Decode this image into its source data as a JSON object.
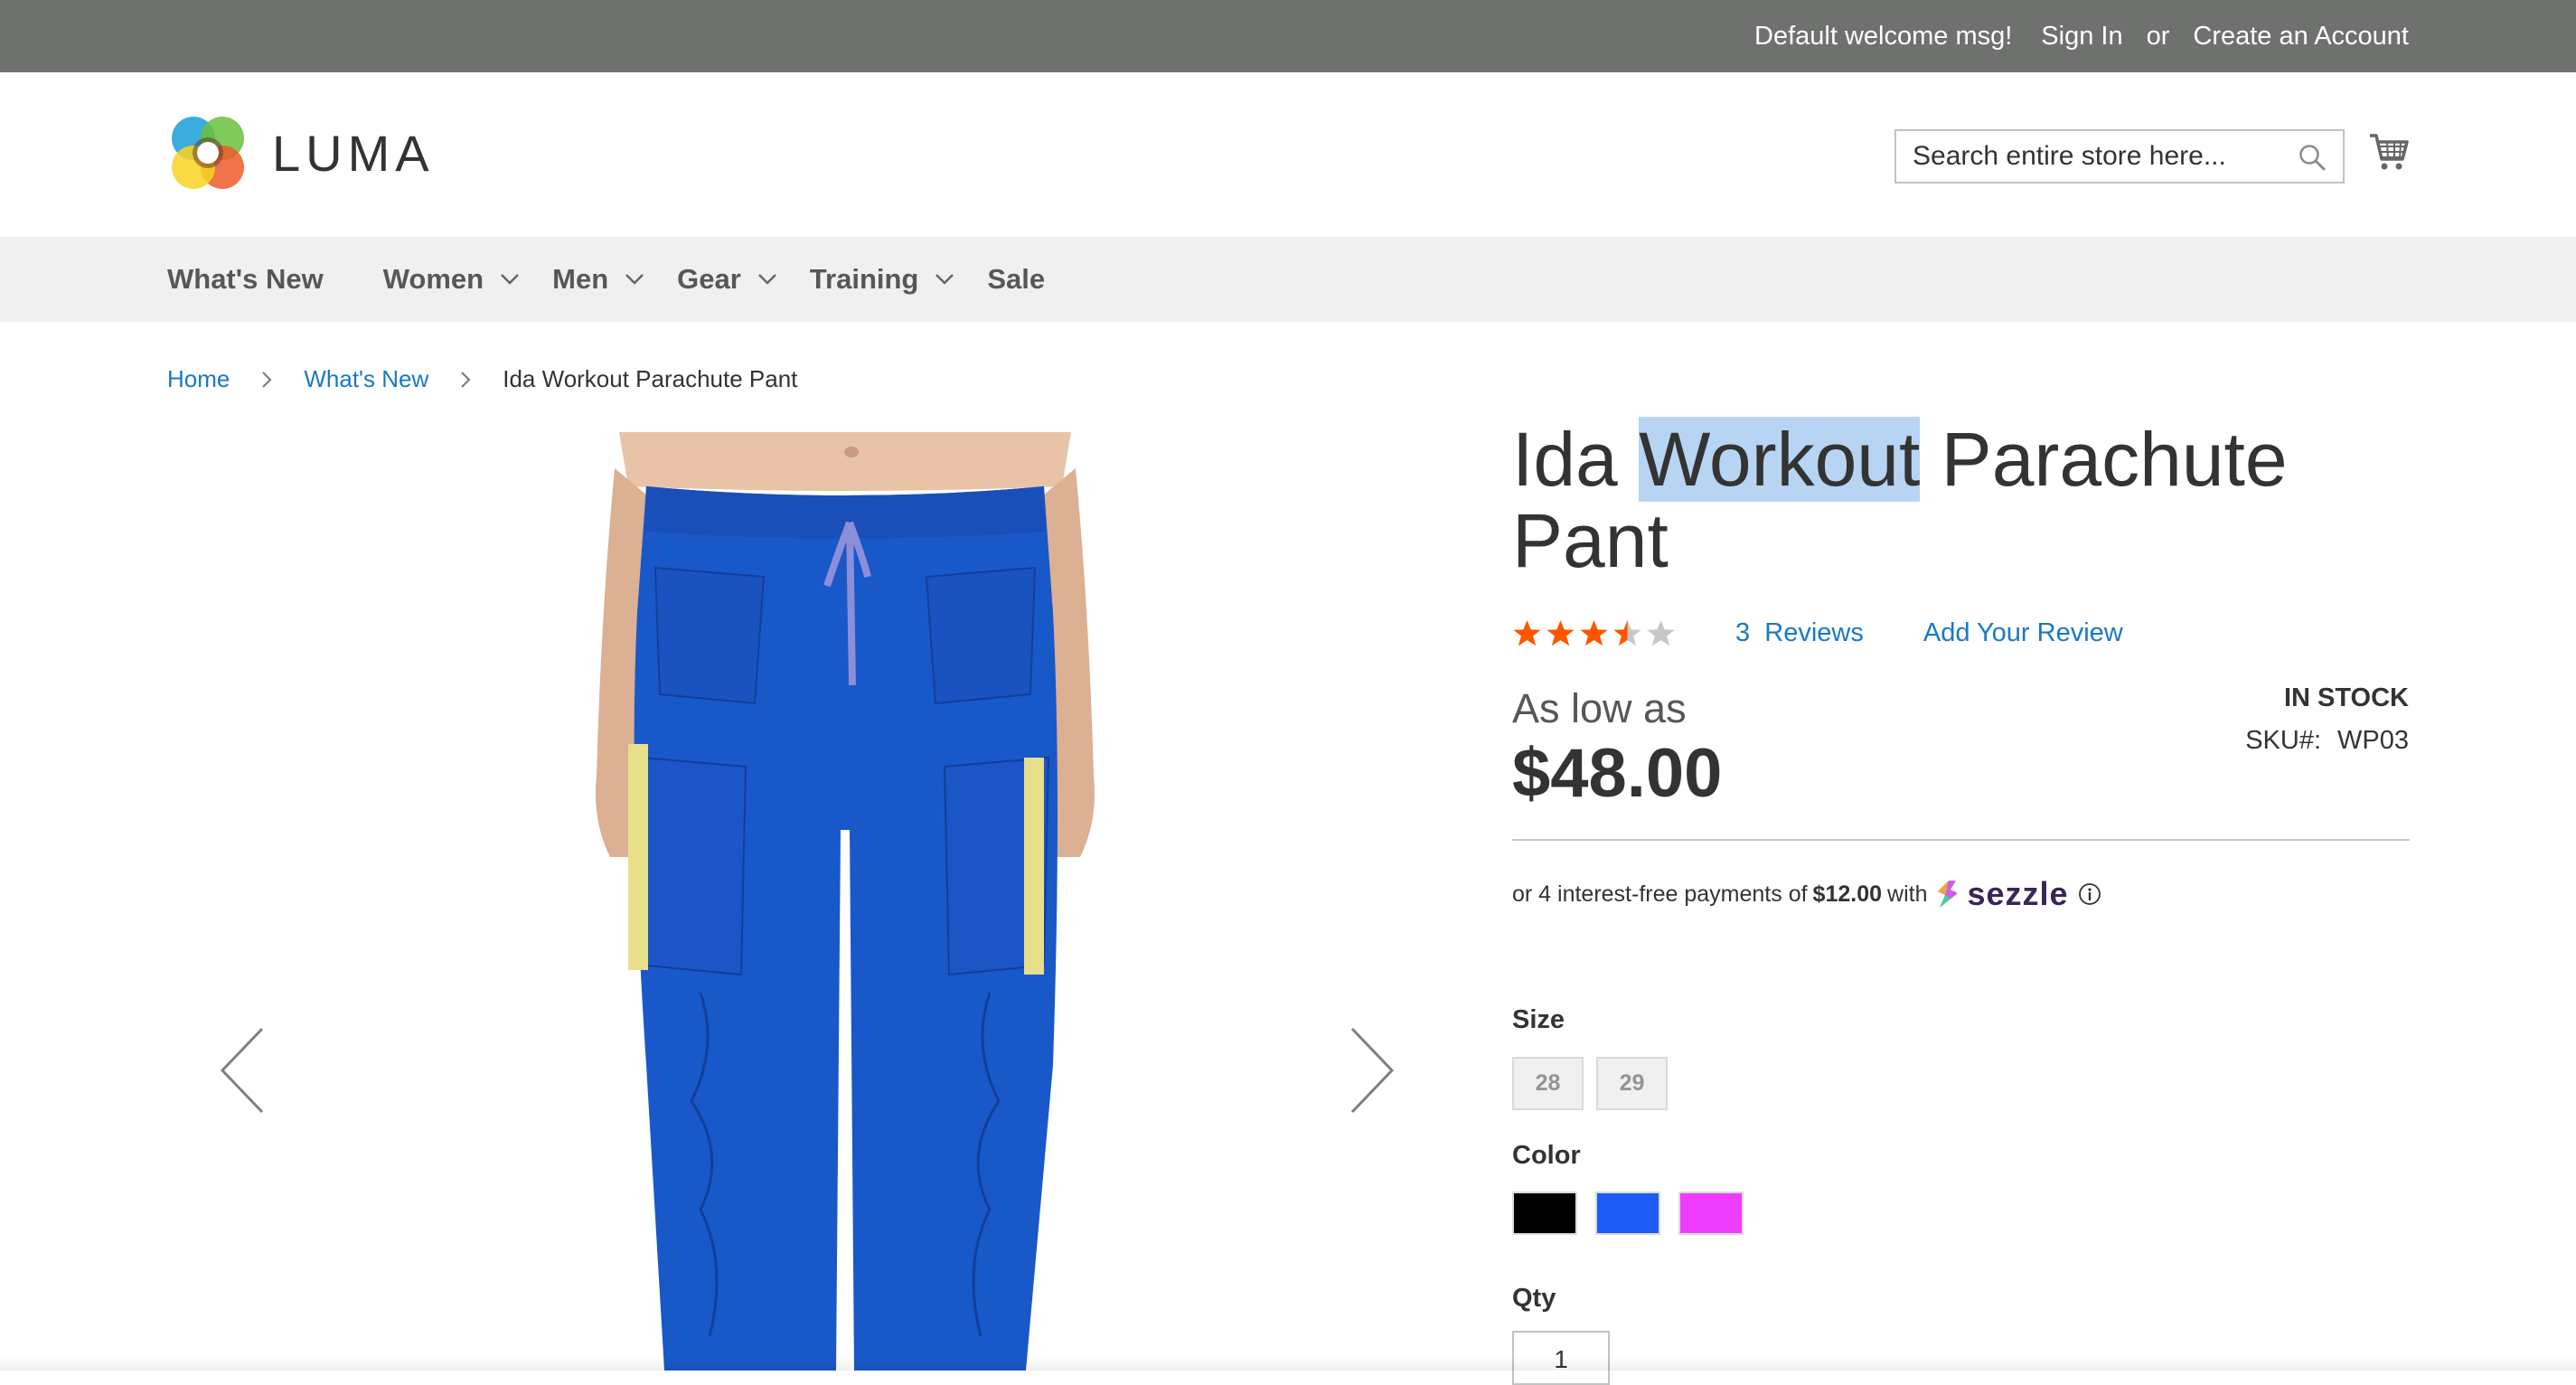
{
  "topbar": {
    "welcome": "Default welcome msg!",
    "sign_in": "Sign In",
    "or": "or",
    "create_account": "Create an Account"
  },
  "header": {
    "logo_text": "LUMA",
    "search_placeholder": "Search entire store here...",
    "search_icon": "search-icon",
    "cart_icon": "cart-icon"
  },
  "nav": {
    "items": [
      {
        "label": "What's New",
        "has_dropdown": false
      },
      {
        "label": "Women",
        "has_dropdown": true
      },
      {
        "label": "Men",
        "has_dropdown": true
      },
      {
        "label": "Gear",
        "has_dropdown": true
      },
      {
        "label": "Training",
        "has_dropdown": true
      },
      {
        "label": "Sale",
        "has_dropdown": false
      }
    ]
  },
  "breadcrumb": {
    "home": "Home",
    "category": "What's New",
    "current": "Ida Workout Parachute Pant"
  },
  "product": {
    "title_before": "Ida ",
    "title_highlight": "Workout",
    "title_after": " Parachute Pant",
    "rating": 3,
    "rating_max": 5,
    "reviews_count": "3",
    "reviews_label": "Reviews",
    "add_review": "Add Your Review",
    "price_prefix": "As low as",
    "price": "$48.00",
    "stock": "IN STOCK",
    "sku_label": "SKU#:",
    "sku": "WP03",
    "sezzle": {
      "text_before": "or 4 interest-free payments of",
      "amount": "$12.00",
      "text_after": "with",
      "brand": "sezzle",
      "info_icon": "info-icon"
    },
    "size_label": "Size",
    "sizes": [
      "28",
      "29"
    ],
    "color_label": "Color",
    "colors": [
      "#000000",
      "#1f5bf5",
      "#ef3dff"
    ],
    "qty_label": "Qty",
    "qty": "1"
  },
  "colors": {
    "topbar_bg": "#6e716e",
    "nav_bg": "#f0f0f0",
    "link": "#1979c3",
    "star_on": "#ff5501",
    "star_off": "#c7c7c7",
    "highlight": "#b8d4f3"
  }
}
